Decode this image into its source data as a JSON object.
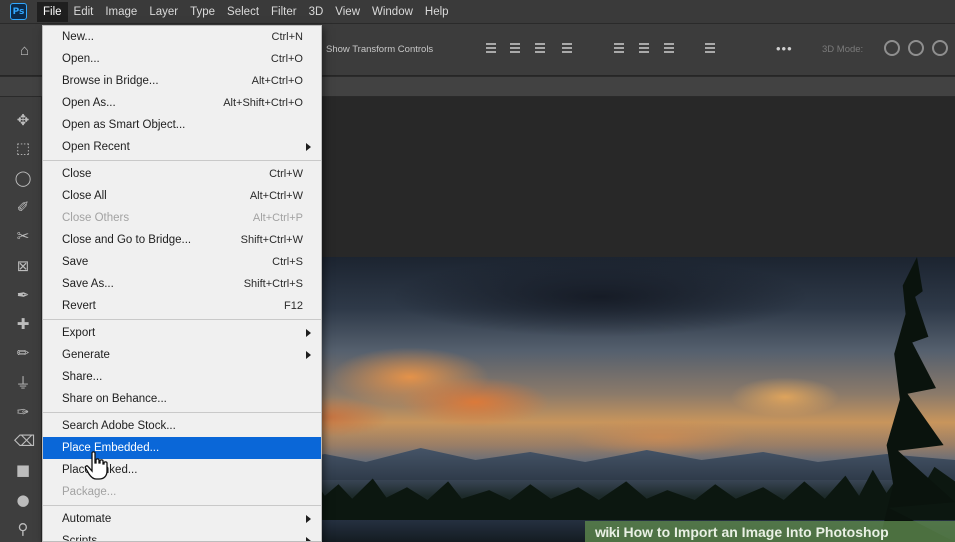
{
  "menubar": {
    "logo": "Ps",
    "items": [
      "File",
      "Edit",
      "Image",
      "Layer",
      "Type",
      "Select",
      "Filter",
      "3D",
      "View",
      "Window",
      "Help"
    ],
    "active_index": 0
  },
  "options_bar": {
    "transform_label": "Show Transform Controls",
    "more_label": "•••",
    "mode_label": "3D Mode:"
  },
  "file_menu": {
    "groups": [
      [
        {
          "label": "New...",
          "shortcut": "Ctrl+N"
        },
        {
          "label": "Open...",
          "shortcut": "Ctrl+O"
        },
        {
          "label": "Browse in Bridge...",
          "shortcut": "Alt+Ctrl+O"
        },
        {
          "label": "Open As...",
          "shortcut": "Alt+Shift+Ctrl+O"
        },
        {
          "label": "Open as Smart Object...",
          "shortcut": ""
        },
        {
          "label": "Open Recent",
          "shortcut": "",
          "submenu": true
        }
      ],
      [
        {
          "label": "Close",
          "shortcut": "Ctrl+W"
        },
        {
          "label": "Close All",
          "shortcut": "Alt+Ctrl+W"
        },
        {
          "label": "Close Others",
          "shortcut": "Alt+Ctrl+P",
          "disabled": true
        },
        {
          "label": "Close and Go to Bridge...",
          "shortcut": "Shift+Ctrl+W"
        },
        {
          "label": "Save",
          "shortcut": "Ctrl+S"
        },
        {
          "label": "Save As...",
          "shortcut": "Shift+Ctrl+S"
        },
        {
          "label": "Revert",
          "shortcut": "F12"
        }
      ],
      [
        {
          "label": "Export",
          "shortcut": "",
          "submenu": true
        },
        {
          "label": "Generate",
          "shortcut": "",
          "submenu": true
        },
        {
          "label": "Share...",
          "shortcut": ""
        },
        {
          "label": "Share on Behance...",
          "shortcut": ""
        }
      ],
      [
        {
          "label": "Search Adobe Stock...",
          "shortcut": ""
        },
        {
          "label": "Place Embedded...",
          "shortcut": "",
          "highlighted": true
        },
        {
          "label": "Place Linked...",
          "shortcut": ""
        },
        {
          "label": "Package...",
          "shortcut": "",
          "disabled": true
        }
      ],
      [
        {
          "label": "Automate",
          "shortcut": "",
          "submenu": true
        },
        {
          "label": "Scripts",
          "shortcut": "",
          "submenu": true
        }
      ]
    ]
  },
  "tools": [
    "move-tool-icon",
    "marquee-tool-icon",
    "lasso-tool-icon",
    "quick-select-tool-icon",
    "crop-tool-icon",
    "frame-tool-icon",
    "eyedropper-tool-icon",
    "healing-brush-tool-icon",
    "brush-tool-icon",
    "clone-stamp-tool-icon",
    "history-brush-tool-icon",
    "eraser-tool-icon",
    "gradient-tool-icon",
    "blur-tool-icon",
    "dodge-tool-icon"
  ],
  "watermark": {
    "brand": "wiki",
    "title": "How to Import an Image Into Photoshop"
  },
  "colors": {
    "menu_highlight": "#0a67d8",
    "ps_brand": "#31a8ff",
    "wikihow_green": "#5c854c"
  }
}
